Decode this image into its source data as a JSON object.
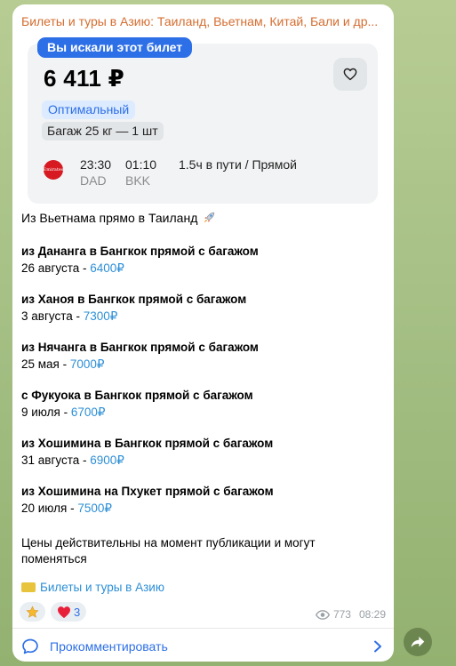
{
  "channel": {
    "title": "Билеты и туры в Азию: Таиланд, Вьетнам, Китай, Бали и др..."
  },
  "ticket": {
    "badge": "Вы искали этот билет",
    "price": "6 411 ₽",
    "tag_optimal": "Оптимальный",
    "tag_baggage": "Багаж 25 кг — 1 шт",
    "airline_logo_text": "Emirates",
    "depart_time": "23:30",
    "arrive_time": "01:10",
    "duration": "1.5ч в пути / Прямой",
    "from_code": "DAD",
    "to_code": "BKK"
  },
  "post": {
    "intro": "Из Вьетнама прямо в Таиланд",
    "routes": [
      {
        "title": "из Дананга в Бангкок прямой с багажом",
        "date": "26 августа - ",
        "price": "6400₽"
      },
      {
        "title": "из Ханоя в Бангкок прямой с багажом",
        "date": "3 августа - ",
        "price": "7300₽"
      },
      {
        "title": "из Нячанга в Бангкок прямой с багажом",
        "date": "25 мая - ",
        "price": "7000₽"
      },
      {
        "title": "с Фукуока в Бангкок прямой с багажом",
        "date": "9 июля - ",
        "price": "6700₽"
      },
      {
        "title": "из Хошимина в Бангкок прямой с багажом",
        "date": "31 августа - ",
        "price": "6900₽"
      },
      {
        "title": "из Хошимина на Пхукет прямой с багажом",
        "date": "20 июля - ",
        "price": "7500₽"
      }
    ],
    "note": "Цены действительны на момент публикации и могут поменяться",
    "channel_link": "Билеты и туры в Азию"
  },
  "reactions": {
    "heart_count": "3"
  },
  "meta": {
    "views": "773",
    "time": "08:29"
  },
  "comments": {
    "label": "Прокомментировать"
  },
  "colors": {
    "accent": "#2d6fe6",
    "link": "#2d8fd6",
    "channel": "#d46d2f"
  }
}
